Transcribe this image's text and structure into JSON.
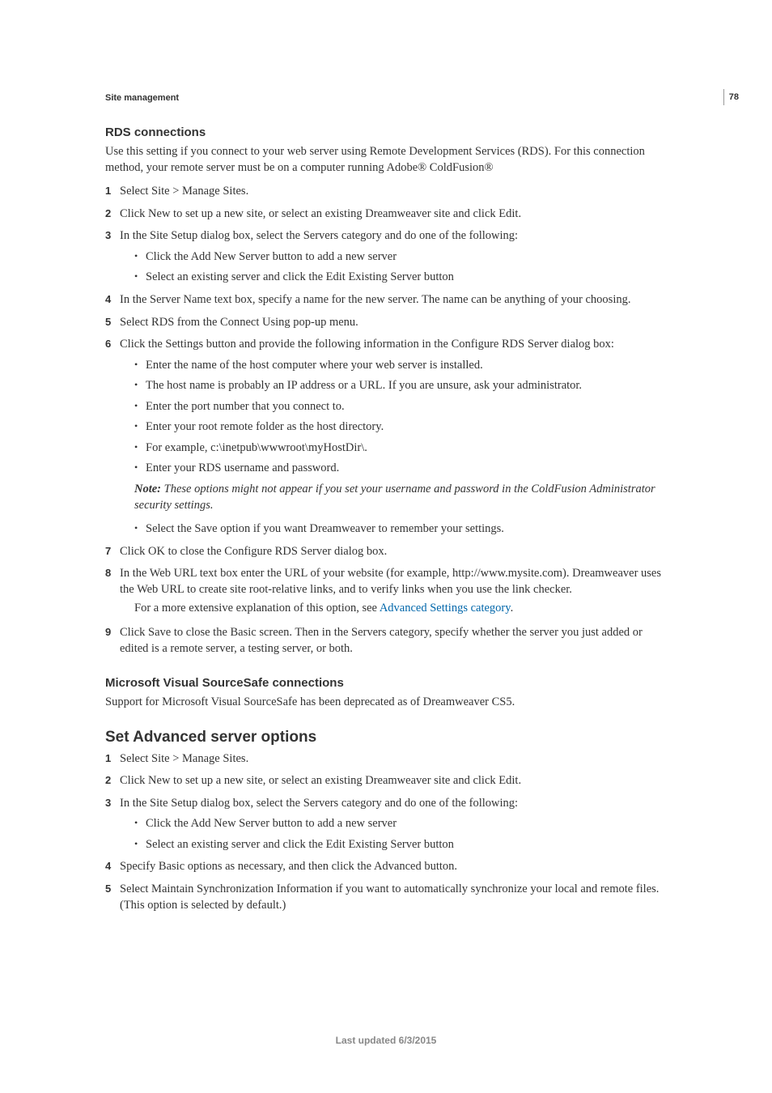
{
  "page": {
    "section_label": "Site management",
    "page_number": "78",
    "footer": "Last updated 6/3/2015"
  },
  "rds": {
    "heading": "RDS connections",
    "intro": "Use this setting if you connect to your web server using Remote Development Services (RDS). For this connection method, your remote server must be on a computer running Adobe® ColdFusion®",
    "steps": {
      "s1": "Select Site > Manage Sites.",
      "s2": "Click New to set up a new site, or select an existing Dreamweaver site and click Edit.",
      "s3": "In the Site Setup dialog box, select the Servers category and do one of the following:",
      "s3_bullets": {
        "b1": "Click the Add New Server button to add a new server",
        "b2": "Select an existing server and click the Edit Existing Server button"
      },
      "s4": "In the Server Name text box, specify a name for the new server. The name can be anything of your choosing.",
      "s5": "Select RDS from the Connect Using pop-up menu.",
      "s6": "Click the Settings button and provide the following information in the Configure RDS Server dialog box:",
      "s6_bullets": {
        "b1": "Enter the name of the host computer where your web server is installed.",
        "b2": "The host name is probably an IP address or a URL. If you are unsure, ask your administrator.",
        "b3": "Enter the port number that you connect to.",
        "b4": "Enter your root remote folder as the host directory.",
        "b5": "For example, c:\\inetpub\\wwwroot\\myHostDir\\.",
        "b6": "Enter your RDS username and password."
      },
      "note_label": "Note: ",
      "note_body": "These options might not appear if you set your username and password in the ColdFusion Administrator security settings.",
      "s6_bullets_after": {
        "b1": "Select the Save option if you want Dreamweaver to remember your settings."
      },
      "s7": "Click OK to close the Configure RDS Server dialog box.",
      "s8": "In the Web URL text box enter the URL of your website (for example, http://www.mysite.com). Dreamweaver uses the Web URL to create site root-relative links, and to verify links when you use the link checker.",
      "s8_extra_pre": "For a more extensive explanation of this option, see ",
      "s8_link": "Advanced Settings category",
      "s8_extra_post": ".",
      "s9": "Click Save to close the Basic screen. Then in the Servers category, specify whether the server you just added or edited is a remote server, a testing server, or both."
    }
  },
  "vss": {
    "heading": "Microsoft Visual SourceSafe connections",
    "body": "Support for Microsoft Visual SourceSafe has been deprecated as of Dreamweaver CS5."
  },
  "adv": {
    "heading": "Set Advanced server options",
    "steps": {
      "s1": "Select Site > Manage Sites.",
      "s2": "Click New to set up a new site, or select an existing Dreamweaver site and click Edit.",
      "s3": "In the Site Setup dialog box, select the Servers category and do one of the following:",
      "s3_bullets": {
        "b1": "Click the Add New Server button to add a new server",
        "b2": "Select an existing server and click the Edit Existing Server button"
      },
      "s4": "Specify Basic options as necessary, and then click the Advanced button.",
      "s5": "Select Maintain Synchronization Information if you want to automatically synchronize your local and remote files. (This option is selected by default.)"
    }
  }
}
